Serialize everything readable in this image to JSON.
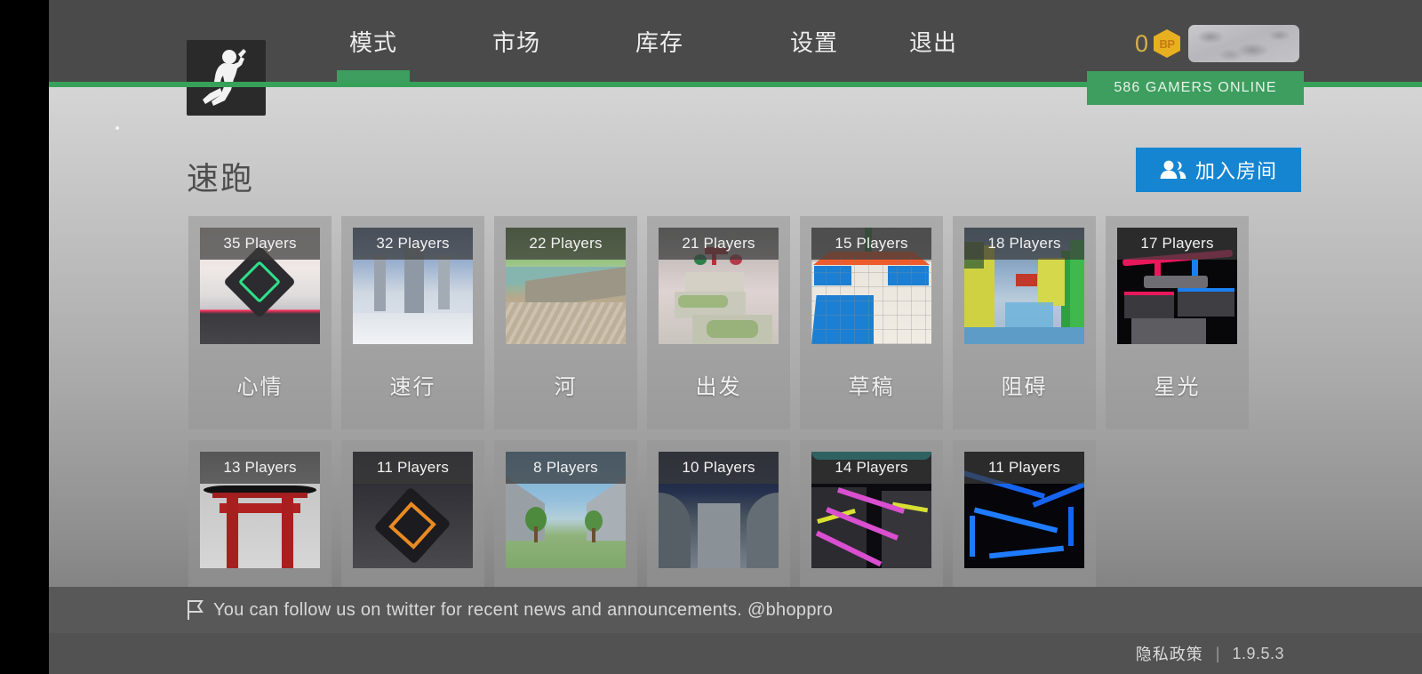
{
  "header": {
    "logo_icon": "running-man-logo",
    "nav_items": [
      {
        "label": "模式",
        "active": true
      },
      {
        "label": "市场",
        "active": false
      },
      {
        "label": "库存",
        "active": false
      },
      {
        "label": "设置",
        "active": false
      },
      {
        "label": "退出",
        "active": false
      }
    ],
    "currency": {
      "amount": "0",
      "coin_label": "BP",
      "coin_icon": "bp-hexagon-coin"
    },
    "account_chip": {
      "icon": "account-placeholder"
    },
    "gamers_online": "586 GAMERS ONLINE"
  },
  "main": {
    "page_title": "速跑",
    "join_room": {
      "label": "加入房间",
      "icon": "users-icon"
    },
    "maps": [
      {
        "name": "心情",
        "players": "35 Players",
        "art": "cube-clouds"
      },
      {
        "name": "速行",
        "players": "32 Players",
        "art": "white-pillars"
      },
      {
        "name": "河",
        "players": "22 Players",
        "art": "river-beach"
      },
      {
        "name": "出发",
        "players": "21 Players",
        "art": "cloud-steps"
      },
      {
        "name": "草稿",
        "players": "15 Players",
        "art": "blue-tile-draft"
      },
      {
        "name": "阻碍",
        "players": "18 Players",
        "art": "colorblock-obstacle"
      },
      {
        "name": "星光",
        "players": "17 Players",
        "art": "neon-dark-platforms"
      },
      {
        "name": "",
        "players": "13 Players",
        "art": "torii-gate"
      },
      {
        "name": "",
        "players": "11 Players",
        "art": "orange-cube"
      },
      {
        "name": "",
        "players": "8 Players",
        "art": "tree-corridor"
      },
      {
        "name": "",
        "players": "10 Players",
        "art": "night-tunnel"
      },
      {
        "name": "",
        "players": "14 Players",
        "art": "pink-neon-path"
      },
      {
        "name": "",
        "players": "11 Players",
        "art": "blue-neon-lines"
      }
    ]
  },
  "footer": {
    "message": "You can follow us on twitter for recent news and announcements. @bhoppro",
    "flag_icon": "flag-icon",
    "privacy_label": "隐私政策",
    "separator": "|",
    "version": "1.9.5.3"
  },
  "colors": {
    "header_bg": "#4a4a4a",
    "accent_green": "#3d9e5f",
    "join_blue": "#1585d1",
    "coin_gold": "#e8b020"
  }
}
